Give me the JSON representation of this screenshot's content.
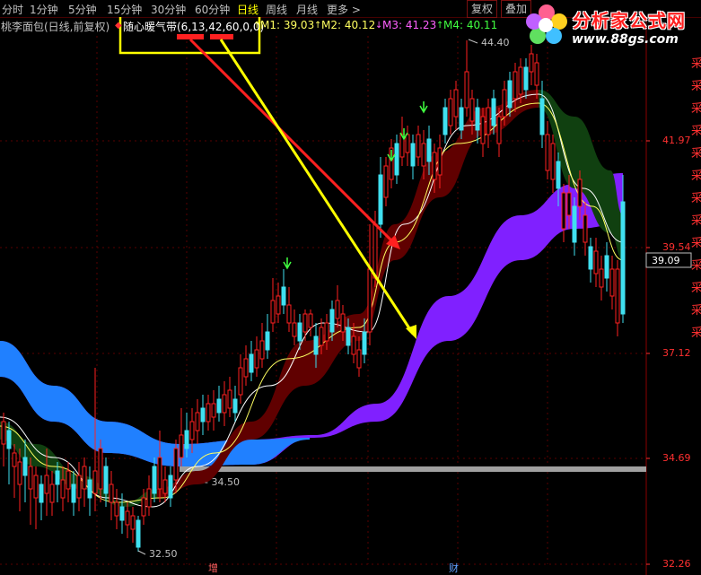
{
  "toolbar": {
    "periods": [
      "分时",
      "1分钟",
      "5分钟",
      "15分钟",
      "30分钟",
      "60分钟",
      "日线",
      "周线",
      "月线",
      "更多 >"
    ],
    "active": "日线",
    "buttons": [
      "复权",
      "叠加"
    ]
  },
  "infobar": {
    "stock": "桃李面包(日线,前复权)",
    "indicator": "随心暖气带(6,13,42,60,0,0)",
    "m1": "M1: 39.03",
    "m2": "M2: 40.12",
    "m3": "M3: 41.23",
    "m4": "M4: 40.11",
    "m1_arrow": "↑",
    "m2_arrow": "↑",
    "m3_arrow": "↓",
    "m4_arrow": "↑"
  },
  "axis": {
    "ticks": [
      "41.97",
      "39.54",
      "37.12",
      "34.69",
      "32.26"
    ],
    "current_price": "39.09"
  },
  "annotations": {
    "high": "44.40",
    "low": "32.50",
    "support": "34.50"
  },
  "bottom_labels": [
    "增",
    "财"
  ],
  "logo": {
    "title": "分析家公式网",
    "url": "www.88gs.com"
  },
  "colors": {
    "up": "#ff2020",
    "down": "#40e0f0",
    "band_dark": "#600000",
    "band_purple": "#8020ff",
    "band_blue": "#2080ff",
    "band_green": "#104010",
    "grid": "#5a0000",
    "highlight": "#ffff00"
  }
}
